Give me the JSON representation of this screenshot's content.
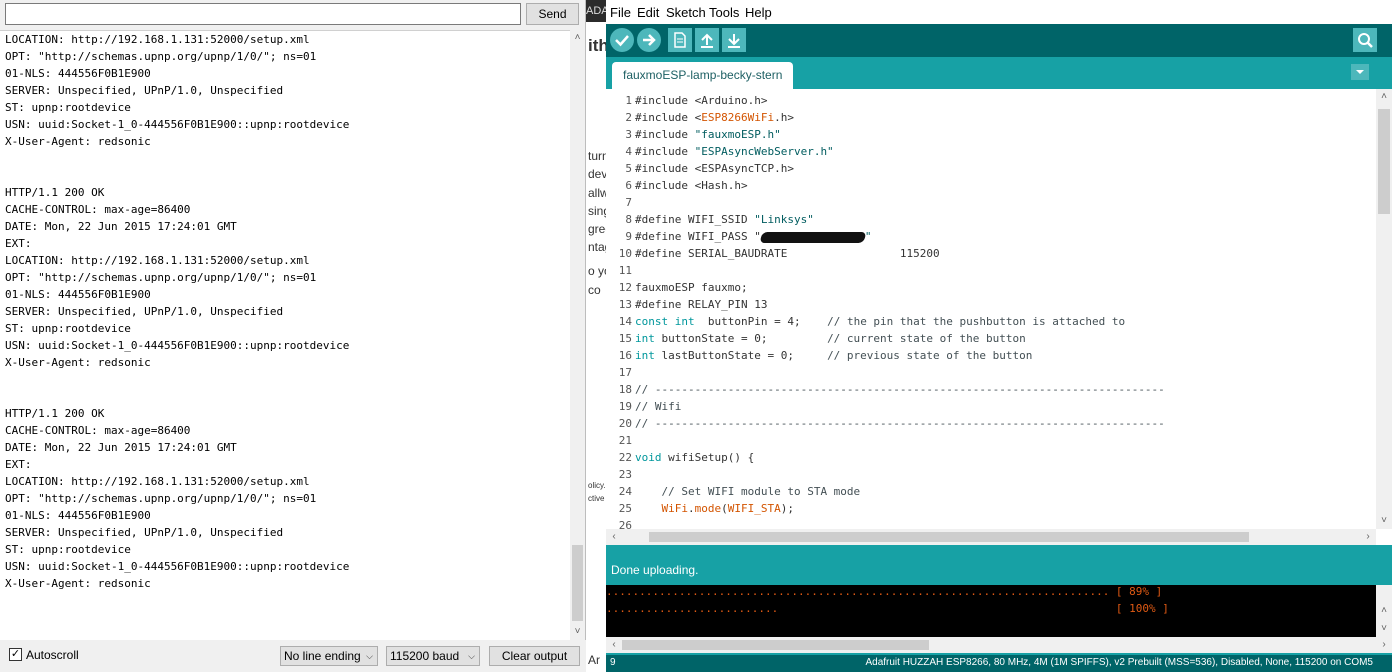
{
  "serial": {
    "input_value": "",
    "send_label": "Send",
    "output": "LOCATION: http://192.168.1.131:52000/setup.xml\nOPT: \"http://schemas.upnp.org/upnp/1/0/\"; ns=01\n01-NLS: 444556F0B1E900\nSERVER: Unspecified, UPnP/1.0, Unspecified\nST: upnp:rootdevice\nUSN: uuid:Socket-1_0-444556F0B1E900::upnp:rootdevice\nX-User-Agent: redsonic\n\n\nHTTP/1.1 200 OK\nCACHE-CONTROL: max-age=86400\nDATE: Mon, 22 Jun 2015 17:24:01 GMT\nEXT:\nLOCATION: http://192.168.1.131:52000/setup.xml\nOPT: \"http://schemas.upnp.org/upnp/1/0/\"; ns=01\n01-NLS: 444556F0B1E900\nSERVER: Unspecified, UPnP/1.0, Unspecified\nST: upnp:rootdevice\nUSN: uuid:Socket-1_0-444556F0B1E900::upnp:rootdevice\nX-User-Agent: redsonic\n\n\nHTTP/1.1 200 OK\nCACHE-CONTROL: max-age=86400\nDATE: Mon, 22 Jun 2015 17:24:01 GMT\nEXT:\nLOCATION: http://192.168.1.131:52000/setup.xml\nOPT: \"http://schemas.upnp.org/upnp/1/0/\"; ns=01\n01-NLS: 444556F0B1E900\nSERVER: Unspecified, UPnP/1.0, Unspecified\nST: upnp:rootdevice\nUSN: uuid:Socket-1_0-444556F0B1E900::upnp:rootdevice\nX-User-Agent: redsonic",
    "autoscroll_label": "Autoscroll",
    "autoscroll_checked": true,
    "line_ending": "No line ending",
    "baud": "115200 baud",
    "clear_label": "Clear output"
  },
  "background_window": {
    "fragments": [
      "ADA",
      "ith",
      "turn",
      "dev",
      "allw",
      "sing",
      "gree",
      "ntag",
      "o yo",
      "co",
      "olicy.",
      "ctive",
      "Ar"
    ]
  },
  "ide": {
    "menu": [
      "File",
      "Edit",
      "Sketch",
      "Tools",
      "Help"
    ],
    "toolbar": {
      "verify": "verify-icon",
      "upload": "upload-icon",
      "new": "new-file-icon",
      "open": "open-icon",
      "save": "save-icon",
      "serial_monitor": "serial-monitor-icon"
    },
    "tab_name": "fauxmoESP-lamp-becky-stern",
    "code_lines": [
      "#include <Arduino.h>",
      "#include <ESP8266WiFi.h>",
      "#include \"fauxmoESP.h\"",
      "#include \"ESPAsyncWebServer.h\"",
      "#include <ESPAsyncTCP.h>",
      "#include <Hash.h>",
      "",
      "#define WIFI_SSID \"Linksys\"",
      "#define WIFI_PASS \"",
      "#define SERIAL_BAUDRATE                 115200",
      "",
      "fauxmoESP fauxmo;",
      "#define RELAY_PIN 13",
      "const int  buttonPin = 4;    // the pin that the pushbutton is attached to",
      "int buttonState = 0;         // current state of the button",
      "int lastButtonState = 0;     // previous state of the button",
      "",
      "// -----------------------------------------------------------------------------",
      "// Wifi",
      "// -----------------------------------------------------------------------------",
      "",
      "void wifiSetup() {",
      "",
      "    // Set WIFI module to STA mode",
      "    WiFi.mode(WIFI_STA);",
      ""
    ],
    "status": "Done uploading.",
    "console_lines": [
      "............................................................................ [ 89% ]",
      "..........................                                                   [ 100% ]"
    ],
    "footer_line": "9",
    "footer_board": "Adafruit HUZZAH ESP8266, 80 MHz, 4M (1M SPIFFS), v2 Prebuilt (MSS=536), Disabled, None, 115200 on COM5",
    "colors": {
      "teal": "#17a1a5",
      "dark_teal": "#006468",
      "console_text": "#e05a14"
    }
  }
}
